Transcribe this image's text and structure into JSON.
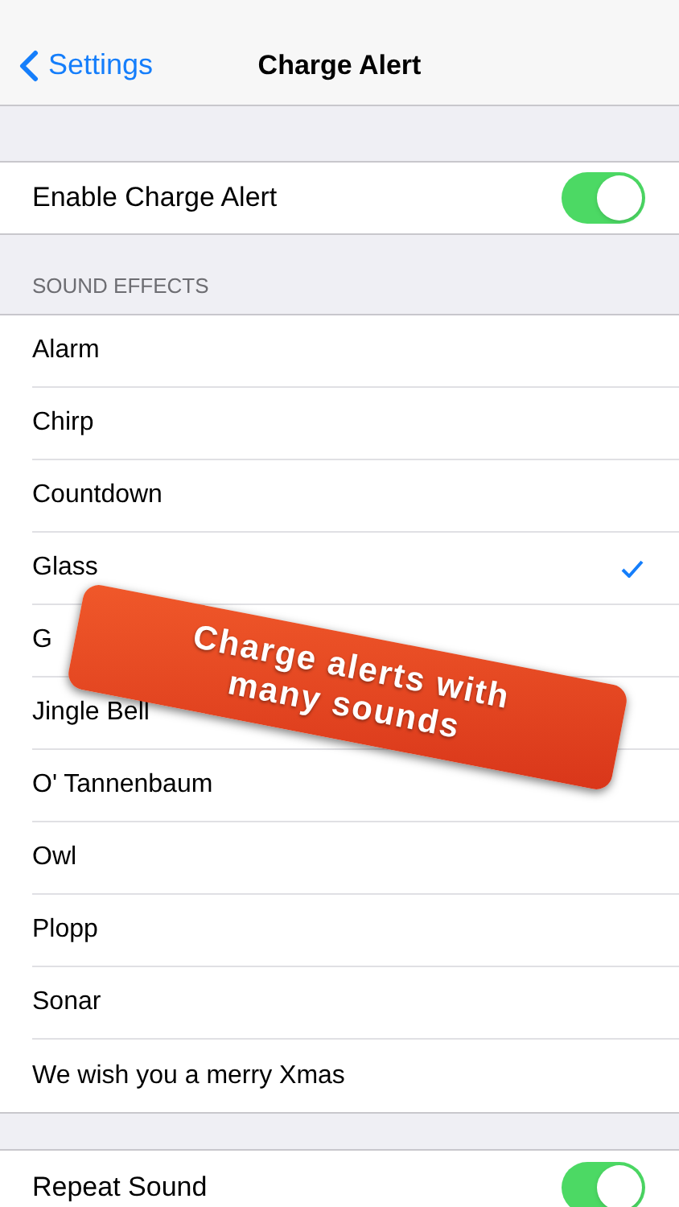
{
  "nav": {
    "back": "Settings",
    "title": "Charge Alert"
  },
  "enable": {
    "label": "Enable Charge Alert",
    "on": true
  },
  "section": "SOUND EFFECTS",
  "sounds": [
    {
      "label": "Alarm",
      "selected": false
    },
    {
      "label": "Chirp",
      "selected": false
    },
    {
      "label": "Countdown",
      "selected": false
    },
    {
      "label": "Glass",
      "selected": true
    },
    {
      "label": "G",
      "selected": false
    },
    {
      "label": "Jingle Bell",
      "selected": false
    },
    {
      "label": "O' Tannenbaum",
      "selected": false
    },
    {
      "label": "Owl",
      "selected": false
    },
    {
      "label": "Plopp",
      "selected": false
    },
    {
      "label": "Sonar",
      "selected": false
    },
    {
      "label": "We wish you a merry Xmas",
      "selected": false
    }
  ],
  "repeat": {
    "label": "Repeat Sound",
    "on": true
  },
  "banner": "Charge alerts with many sounds"
}
